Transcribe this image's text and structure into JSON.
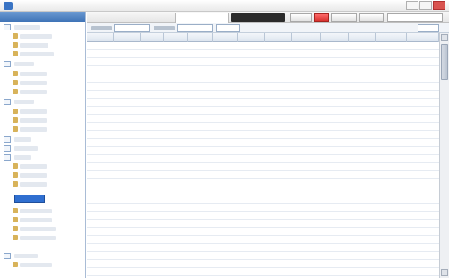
{
  "colors": {
    "accent": "#3f73b6",
    "selection": "#2f6fd0",
    "close_button": "#d9534f"
  },
  "icons": {
    "app_logo": "app-logo-icon",
    "minimize": "minimize-icon",
    "maximize": "maximize-icon",
    "close": "close-icon",
    "tree_expander": "tree-expander-icon",
    "tree_leaf": "tree-leaf-icon"
  }
}
